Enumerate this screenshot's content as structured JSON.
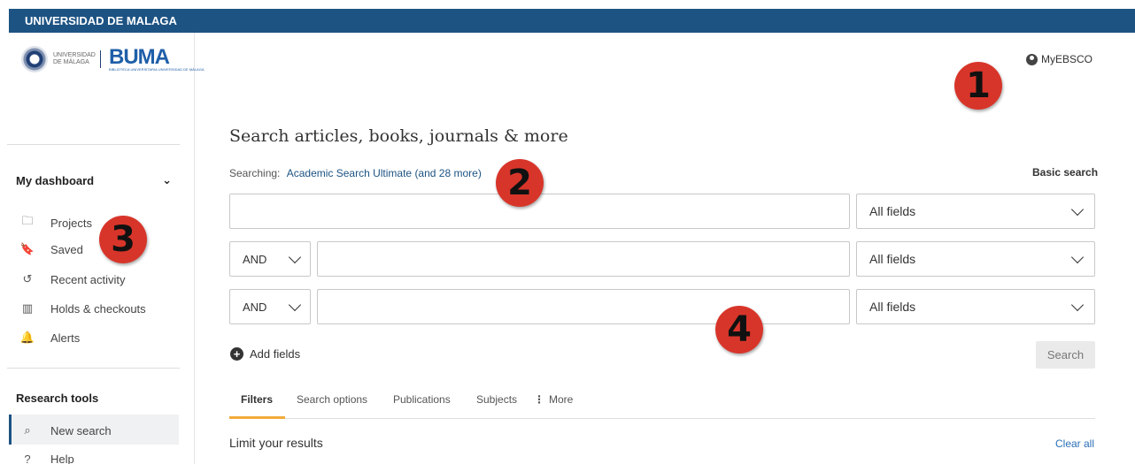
{
  "topbar": {
    "institution": "UNIVERSIDAD DE MALAGA"
  },
  "logo": {
    "uni_text": "UNIVERSIDAD DE MÁLAGA",
    "buma": "BUMA",
    "buma_sub": "BIBLIOTECA UNIVERSITARIA UNIVERSIDAD DE MÁLAGA"
  },
  "sidebar": {
    "dashboard_label": "My dashboard",
    "items": [
      {
        "label": "Projects",
        "icon": "folder-icon",
        "glyph": "🗀"
      },
      {
        "label": "Saved",
        "icon": "bookmark-icon",
        "glyph": "🔖"
      },
      {
        "label": "Recent activity",
        "icon": "history-icon",
        "glyph": "↺"
      },
      {
        "label": "Holds & checkouts",
        "icon": "books-icon",
        "glyph": "▥"
      },
      {
        "label": "Alerts",
        "icon": "bell-icon",
        "glyph": "🔔"
      }
    ],
    "research_tools_label": "Research tools",
    "tools": [
      {
        "label": "New search",
        "icon": "search-icon",
        "glyph": "⌕"
      },
      {
        "label": "Help",
        "icon": "help-icon",
        "glyph": "?"
      }
    ]
  },
  "header": {
    "account_label": "MyEBSCO"
  },
  "main": {
    "title": "Search articles, books, journals & more",
    "searching_label": "Searching:",
    "databases": "Academic Search Ultimate (and 28 more)",
    "basic_search": "Basic search",
    "rows": [
      {
        "operator": "",
        "query": "",
        "field": "All fields"
      },
      {
        "operator": "AND",
        "query": "",
        "field": "All fields"
      },
      {
        "operator": "AND",
        "query": "",
        "field": "All fields"
      }
    ],
    "add_fields": "Add fields",
    "search_button": "Search",
    "tabs": [
      "Filters",
      "Search options",
      "Publications",
      "Subjects",
      "More"
    ],
    "limit_label": "Limit your results",
    "clear_all": "Clear all"
  },
  "markers": [
    "1",
    "2",
    "3",
    "4"
  ],
  "colors": {
    "topbar": "#1d5383",
    "marker": "#d8352a",
    "active_tab": "#f2ab3b",
    "link": "#1d5383"
  }
}
